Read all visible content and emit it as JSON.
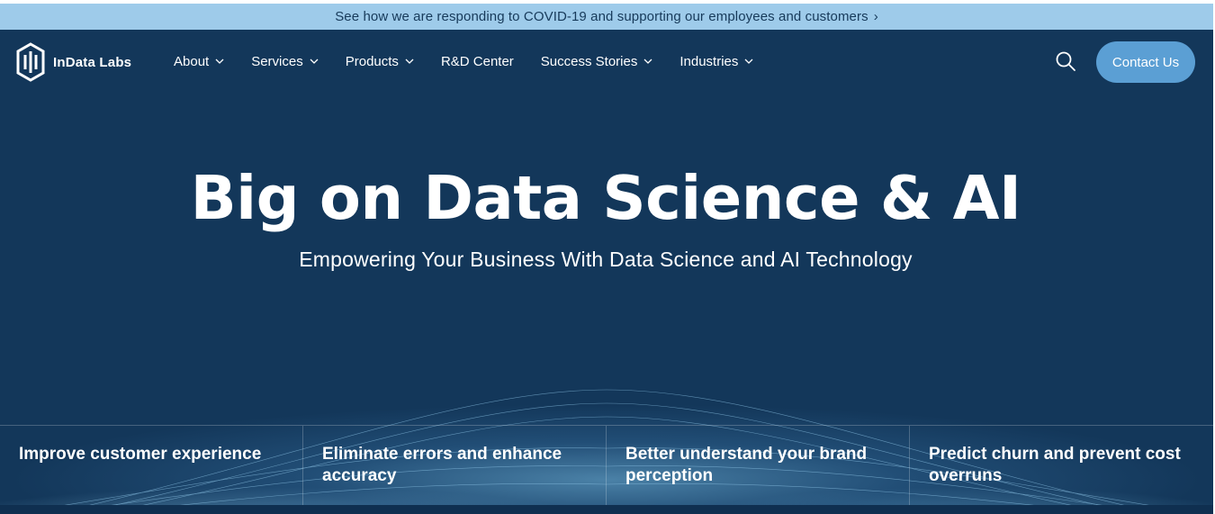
{
  "banner": {
    "text": "See how we are responding to COVID-19 and supporting our employees and customers",
    "arrow": "›"
  },
  "brand": {
    "name": "InData Labs",
    "icon": "indata-logo-icon"
  },
  "nav": {
    "items": [
      {
        "label": "About",
        "has_dropdown": true
      },
      {
        "label": "Services",
        "has_dropdown": true
      },
      {
        "label": "Products",
        "has_dropdown": true
      },
      {
        "label": "R&D Center",
        "has_dropdown": false
      },
      {
        "label": "Success Stories",
        "has_dropdown": true
      },
      {
        "label": "Industries",
        "has_dropdown": true
      }
    ],
    "search_icon": "search-icon",
    "contact_label": "Contact Us"
  },
  "hero": {
    "headline": "Big on Data Science & AI",
    "subhead": "Empowering Your Business With Data Science and AI Technology"
  },
  "features": [
    {
      "label": "Improve customer experience"
    },
    {
      "label": "Eliminate errors and enhance accuracy"
    },
    {
      "label": "Better understand your brand perception"
    },
    {
      "label": "Predict churn and prevent cost overruns"
    }
  ],
  "colors": {
    "banner_bg": "#9ecbea",
    "hero_bg": "#13375a",
    "accent": "#5b9fd4",
    "text_light": "#ffffff"
  }
}
